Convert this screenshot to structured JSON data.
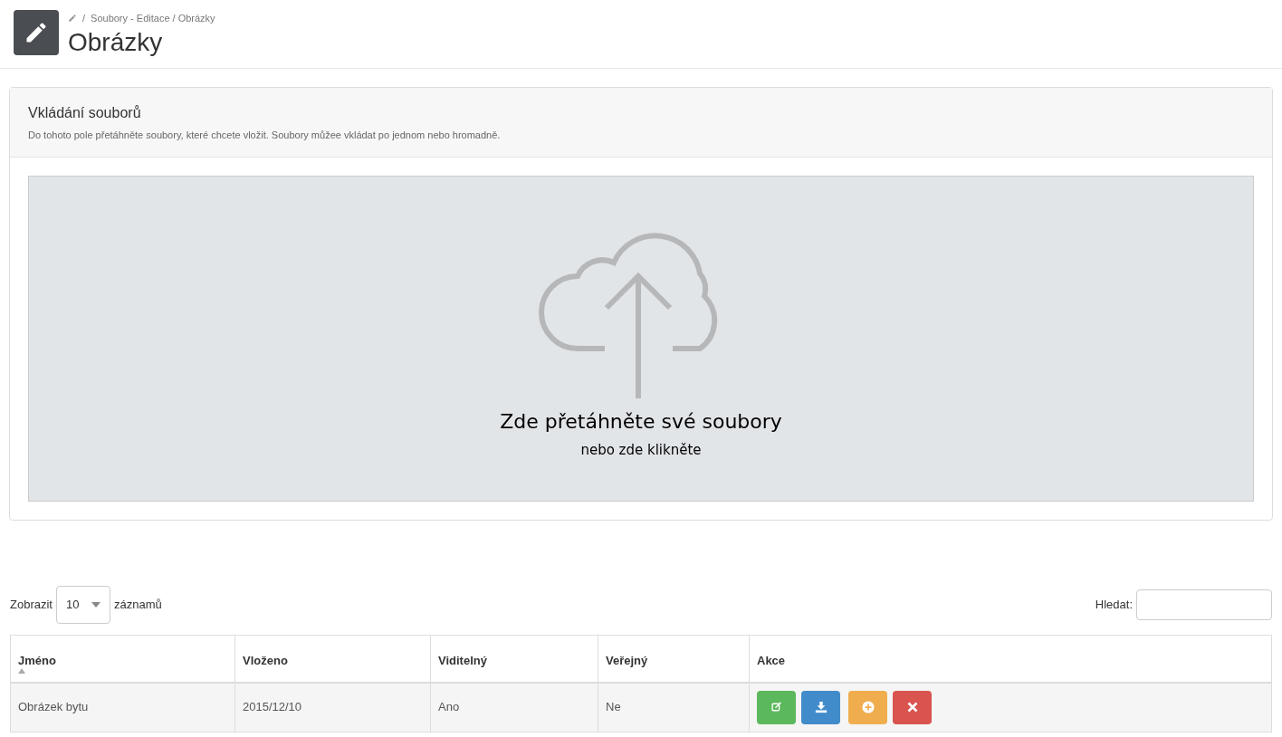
{
  "breadcrumb": {
    "separator": "/",
    "path": "Soubory - Editace / Obrázky"
  },
  "page_title": "Obrázky",
  "upload_panel": {
    "title": "Vkládání souborů",
    "description": "Do tohoto pole přetáhněte soubory, které chcete vložit. Soubory můžee vkládat po jednom nebo hromadně.",
    "dropzone": {
      "title": "Zde přetáhněte své soubory",
      "subtitle": "nebo zde klikněte"
    }
  },
  "table_controls": {
    "show_label": "Zobrazit",
    "page_size": "10",
    "records_label": "záznamů",
    "search_label": "Hledat:"
  },
  "table": {
    "columns": [
      {
        "label": "Jméno",
        "sorted": true
      },
      {
        "label": "Vloženo",
        "sorted": false
      },
      {
        "label": "Viditelný",
        "sorted": false
      },
      {
        "label": "Veřejný",
        "sorted": false
      },
      {
        "label": "Akce",
        "sorted": false
      }
    ],
    "rows": [
      {
        "cells": [
          "Obrázek bytu",
          "2015/12/10",
          "Ano",
          "Ne"
        ],
        "actions": [
          {
            "kind": "edit"
          },
          {
            "kind": "download"
          },
          {
            "kind": "add"
          },
          {
            "kind": "delete"
          }
        ]
      }
    ]
  }
}
